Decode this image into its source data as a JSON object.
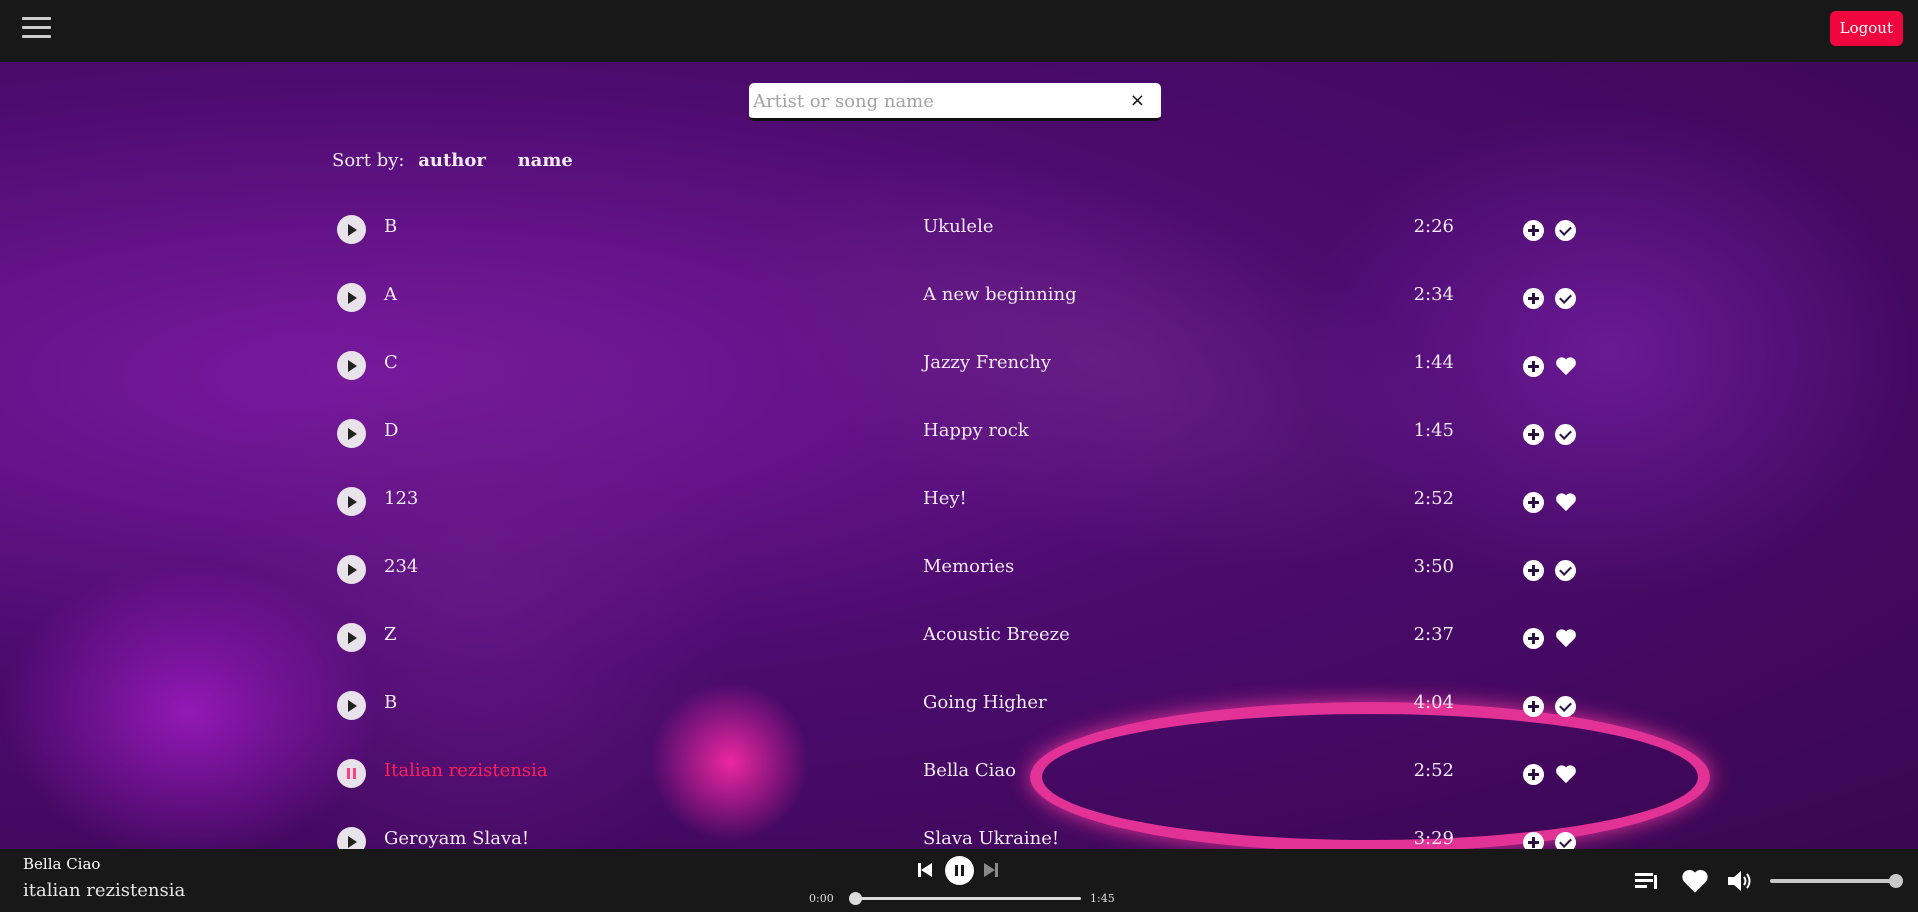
{
  "header": {
    "menu_icon": "hamburger-menu-icon",
    "logout_label": "Logout"
  },
  "search": {
    "placeholder": "Artist or song name",
    "value": "",
    "clear_icon": "×"
  },
  "sort": {
    "label": "Sort by:",
    "options": [
      "author",
      "name"
    ]
  },
  "songs": [
    {
      "author": "B",
      "title": "Ukulele",
      "duration": "2:26",
      "mark": "check",
      "playing": false
    },
    {
      "author": "A",
      "title": "A new beginning",
      "duration": "2:34",
      "mark": "check",
      "playing": false
    },
    {
      "author": "C",
      "title": "Jazzy Frenchy",
      "duration": "1:44",
      "mark": "heart",
      "playing": false
    },
    {
      "author": "D",
      "title": "Happy rock",
      "duration": "1:45",
      "mark": "check",
      "playing": false
    },
    {
      "author": "123",
      "title": "Hey!",
      "duration": "2:52",
      "mark": "heart",
      "playing": false
    },
    {
      "author": "234",
      "title": "Memories",
      "duration": "3:50",
      "mark": "check",
      "playing": false
    },
    {
      "author": "Z",
      "title": "Acoustic Breeze",
      "duration": "2:37",
      "mark": "heart",
      "playing": false
    },
    {
      "author": "B",
      "title": "Going Higher",
      "duration": "4:04",
      "mark": "check",
      "playing": false
    },
    {
      "author": "Italian rezistensia",
      "title": "Bella Ciao",
      "duration": "2:52",
      "mark": "heart",
      "playing": true
    },
    {
      "author": "Geroyam Slava!",
      "title": "Slava Ukraine!",
      "duration": "3:29",
      "mark": "check",
      "playing": false
    }
  ],
  "player": {
    "now_title": "Bella Ciao",
    "now_artist": "italian rezistensia",
    "current_time": "0:00",
    "total_time": "1:45",
    "progress": 0,
    "volume": 1.0
  },
  "colors": {
    "accent": "#f0063e",
    "active_text": "#ff1f56",
    "bar": "#191819"
  }
}
